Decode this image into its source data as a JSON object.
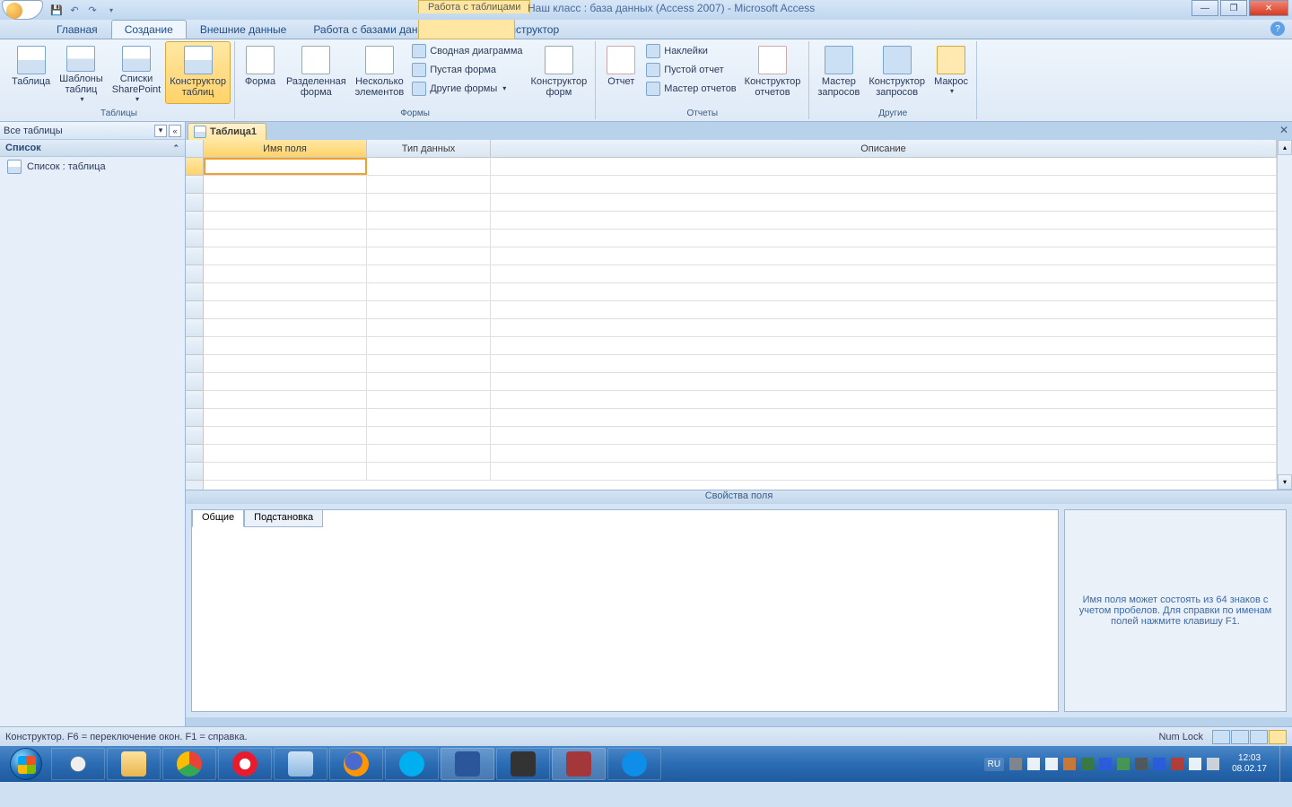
{
  "titlebar": {
    "contextual_label": "Работа с таблицами",
    "title": "Наш класс : база данных (Access 2007) - Microsoft Access"
  },
  "tabs": {
    "home": "Главная",
    "create": "Создание",
    "external": "Внешние данные",
    "db_tools": "Работа с базами данных",
    "designer": "Конструктор"
  },
  "ribbon": {
    "tables": {
      "label": "Таблицы",
      "table": "Таблица",
      "templates": "Шаблоны\nтаблиц",
      "sharepoint": "Списки\nSharePoint",
      "designer": "Конструктор\nтаблиц"
    },
    "forms": {
      "label": "Формы",
      "form": "Форма",
      "split": "Разделенная\nформа",
      "multiple": "Несколько\nэлементов",
      "pivot_chart": "Сводная диаграмма",
      "blank_form": "Пустая форма",
      "other_forms": "Другие формы",
      "form_designer": "Конструктор\nформ"
    },
    "reports": {
      "label": "Отчеты",
      "report": "Отчет",
      "labels": "Наклейки",
      "blank_report": "Пустой отчет",
      "report_wizard": "Мастер отчетов",
      "report_designer": "Конструктор\nотчетов"
    },
    "other": {
      "label": "Другие",
      "query_wizard": "Мастер\nзапросов",
      "query_designer": "Конструктор\nзапросов",
      "macro": "Макрос"
    }
  },
  "navpane": {
    "header": "Все таблицы",
    "group": "Список",
    "item1": "Список : таблица"
  },
  "doc": {
    "tab": "Таблица1",
    "col_name": "Имя поля",
    "col_type": "Тип данных",
    "col_desc": "Описание"
  },
  "field_props": {
    "header": "Свойства поля",
    "tab_general": "Общие",
    "tab_lookup": "Подстановка",
    "hint": "Имя поля может состоять из 64 знаков с учетом пробелов.  Для справки по именам полей нажмите клавишу F1."
  },
  "statusbar": {
    "text": "Конструктор.  F6 = переключение окон.  F1 = справка.",
    "numlock": "Num Lock"
  },
  "taskbar": {
    "lang": "RU",
    "time": "12:03",
    "date": "08.02.17"
  }
}
